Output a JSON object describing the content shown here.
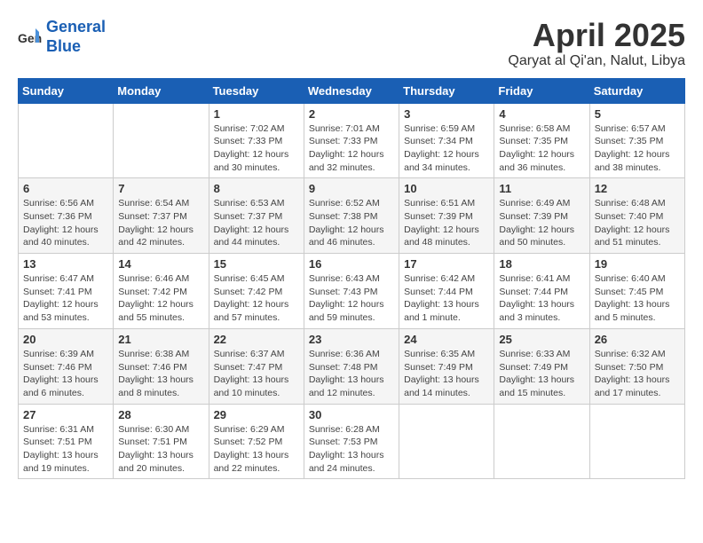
{
  "header": {
    "logo_line1": "General",
    "logo_line2": "Blue",
    "month_title": "April 2025",
    "subtitle": "Qaryat al Qi'an, Nalut, Libya"
  },
  "days_of_week": [
    "Sunday",
    "Monday",
    "Tuesday",
    "Wednesday",
    "Thursday",
    "Friday",
    "Saturday"
  ],
  "weeks": [
    [
      {
        "day": "",
        "info": ""
      },
      {
        "day": "",
        "info": ""
      },
      {
        "day": "1",
        "info": "Sunrise: 7:02 AM\nSunset: 7:33 PM\nDaylight: 12 hours and 30 minutes."
      },
      {
        "day": "2",
        "info": "Sunrise: 7:01 AM\nSunset: 7:33 PM\nDaylight: 12 hours and 32 minutes."
      },
      {
        "day": "3",
        "info": "Sunrise: 6:59 AM\nSunset: 7:34 PM\nDaylight: 12 hours and 34 minutes."
      },
      {
        "day": "4",
        "info": "Sunrise: 6:58 AM\nSunset: 7:35 PM\nDaylight: 12 hours and 36 minutes."
      },
      {
        "day": "5",
        "info": "Sunrise: 6:57 AM\nSunset: 7:35 PM\nDaylight: 12 hours and 38 minutes."
      }
    ],
    [
      {
        "day": "6",
        "info": "Sunrise: 6:56 AM\nSunset: 7:36 PM\nDaylight: 12 hours and 40 minutes."
      },
      {
        "day": "7",
        "info": "Sunrise: 6:54 AM\nSunset: 7:37 PM\nDaylight: 12 hours and 42 minutes."
      },
      {
        "day": "8",
        "info": "Sunrise: 6:53 AM\nSunset: 7:37 PM\nDaylight: 12 hours and 44 minutes."
      },
      {
        "day": "9",
        "info": "Sunrise: 6:52 AM\nSunset: 7:38 PM\nDaylight: 12 hours and 46 minutes."
      },
      {
        "day": "10",
        "info": "Sunrise: 6:51 AM\nSunset: 7:39 PM\nDaylight: 12 hours and 48 minutes."
      },
      {
        "day": "11",
        "info": "Sunrise: 6:49 AM\nSunset: 7:39 PM\nDaylight: 12 hours and 50 minutes."
      },
      {
        "day": "12",
        "info": "Sunrise: 6:48 AM\nSunset: 7:40 PM\nDaylight: 12 hours and 51 minutes."
      }
    ],
    [
      {
        "day": "13",
        "info": "Sunrise: 6:47 AM\nSunset: 7:41 PM\nDaylight: 12 hours and 53 minutes."
      },
      {
        "day": "14",
        "info": "Sunrise: 6:46 AM\nSunset: 7:42 PM\nDaylight: 12 hours and 55 minutes."
      },
      {
        "day": "15",
        "info": "Sunrise: 6:45 AM\nSunset: 7:42 PM\nDaylight: 12 hours and 57 minutes."
      },
      {
        "day": "16",
        "info": "Sunrise: 6:43 AM\nSunset: 7:43 PM\nDaylight: 12 hours and 59 minutes."
      },
      {
        "day": "17",
        "info": "Sunrise: 6:42 AM\nSunset: 7:44 PM\nDaylight: 13 hours and 1 minute."
      },
      {
        "day": "18",
        "info": "Sunrise: 6:41 AM\nSunset: 7:44 PM\nDaylight: 13 hours and 3 minutes."
      },
      {
        "day": "19",
        "info": "Sunrise: 6:40 AM\nSunset: 7:45 PM\nDaylight: 13 hours and 5 minutes."
      }
    ],
    [
      {
        "day": "20",
        "info": "Sunrise: 6:39 AM\nSunset: 7:46 PM\nDaylight: 13 hours and 6 minutes."
      },
      {
        "day": "21",
        "info": "Sunrise: 6:38 AM\nSunset: 7:46 PM\nDaylight: 13 hours and 8 minutes."
      },
      {
        "day": "22",
        "info": "Sunrise: 6:37 AM\nSunset: 7:47 PM\nDaylight: 13 hours and 10 minutes."
      },
      {
        "day": "23",
        "info": "Sunrise: 6:36 AM\nSunset: 7:48 PM\nDaylight: 13 hours and 12 minutes."
      },
      {
        "day": "24",
        "info": "Sunrise: 6:35 AM\nSunset: 7:49 PM\nDaylight: 13 hours and 14 minutes."
      },
      {
        "day": "25",
        "info": "Sunrise: 6:33 AM\nSunset: 7:49 PM\nDaylight: 13 hours and 15 minutes."
      },
      {
        "day": "26",
        "info": "Sunrise: 6:32 AM\nSunset: 7:50 PM\nDaylight: 13 hours and 17 minutes."
      }
    ],
    [
      {
        "day": "27",
        "info": "Sunrise: 6:31 AM\nSunset: 7:51 PM\nDaylight: 13 hours and 19 minutes."
      },
      {
        "day": "28",
        "info": "Sunrise: 6:30 AM\nSunset: 7:51 PM\nDaylight: 13 hours and 20 minutes."
      },
      {
        "day": "29",
        "info": "Sunrise: 6:29 AM\nSunset: 7:52 PM\nDaylight: 13 hours and 22 minutes."
      },
      {
        "day": "30",
        "info": "Sunrise: 6:28 AM\nSunset: 7:53 PM\nDaylight: 13 hours and 24 minutes."
      },
      {
        "day": "",
        "info": ""
      },
      {
        "day": "",
        "info": ""
      },
      {
        "day": "",
        "info": ""
      }
    ]
  ]
}
